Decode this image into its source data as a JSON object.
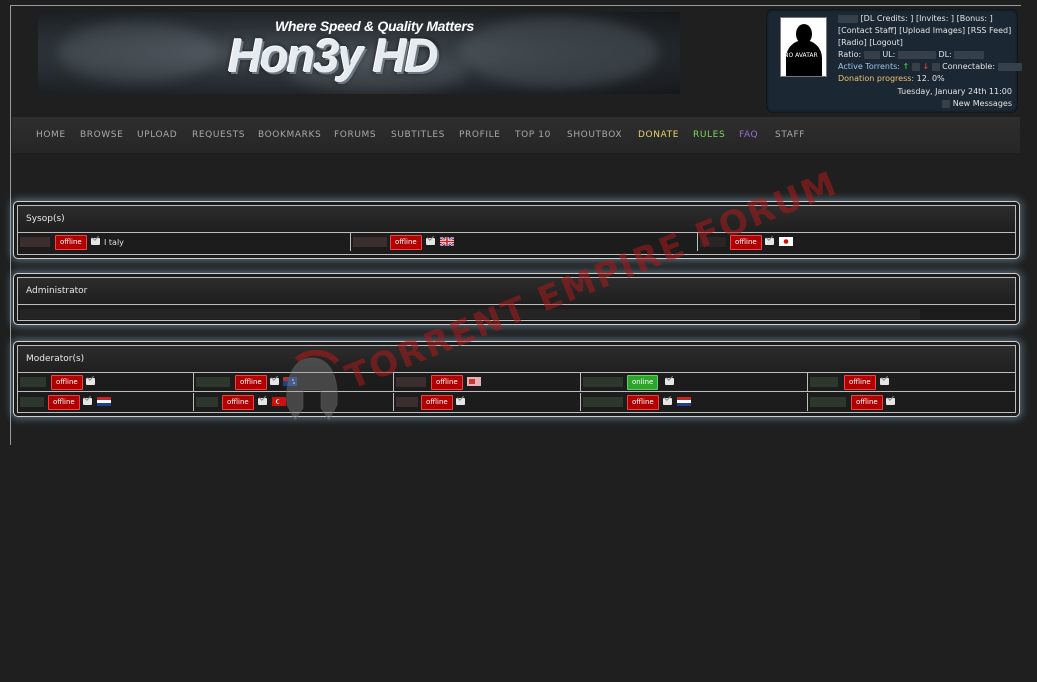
{
  "banner": {
    "tagline": "Where Speed & Quality Matters",
    "logo": "Hon3y HD"
  },
  "userpanel": {
    "avatar_text": "NO AVATAR",
    "line1": "[DL Credits:  ] [Invites:  ] [Bonus:  ]",
    "line2": "[Contact Staff] [Upload Images] [RSS Feed]",
    "line3": "[Radio] [Logout]",
    "ratio_label": "Ratio:",
    "ul_label": "UL:",
    "dl_label": "DL:",
    "active_label": "Active Torrents:",
    "connectable_label": "Connectable:",
    "donation_label": "Donation progress:",
    "donation_value": "12. 0%",
    "date": "Tuesday, January 24th 11:00",
    "new_messages": "New Messages"
  },
  "nav": [
    {
      "label": "HOME",
      "color": "#a8a8a8"
    },
    {
      "label": "BROWSE",
      "color": "#a8a8a8"
    },
    {
      "label": "UPLOAD",
      "color": "#a8a8a8"
    },
    {
      "label": "REQUESTS",
      "color": "#a8a8a8"
    },
    {
      "label": "BOOKMARKS",
      "color": "#a8a8a8"
    },
    {
      "label": "FORUMS",
      "color": "#a8a8a8"
    },
    {
      "label": "SUBTITLES",
      "color": "#a8a8a8"
    },
    {
      "label": "PROFILE",
      "color": "#a8a8a8"
    },
    {
      "label": "TOP 10",
      "color": "#a8a8a8"
    },
    {
      "label": "SHOUTBOX",
      "color": "#a8a8a8"
    },
    {
      "label": "DONATE",
      "color": "#e6d26a"
    },
    {
      "label": "RULES",
      "color": "#7ed957"
    },
    {
      "label": "FAQ",
      "color": "#9b6bd6"
    },
    {
      "label": "STAFF",
      "color": "#a8a8a8"
    }
  ],
  "sysops": {
    "title": "Sysop(s)",
    "status_text": "offline",
    "country": "I taly"
  },
  "admins": {
    "title": "Administrator"
  },
  "moderators": {
    "title": "Moderator(s)",
    "offline_text": "offline",
    "online_text": "online"
  },
  "watermark": "TORRENT EMPIRE FORUM",
  "colors": {
    "offline": "#b00000",
    "online": "#2da52d",
    "panel": "#1b2733",
    "glow": "#96c8e6"
  }
}
